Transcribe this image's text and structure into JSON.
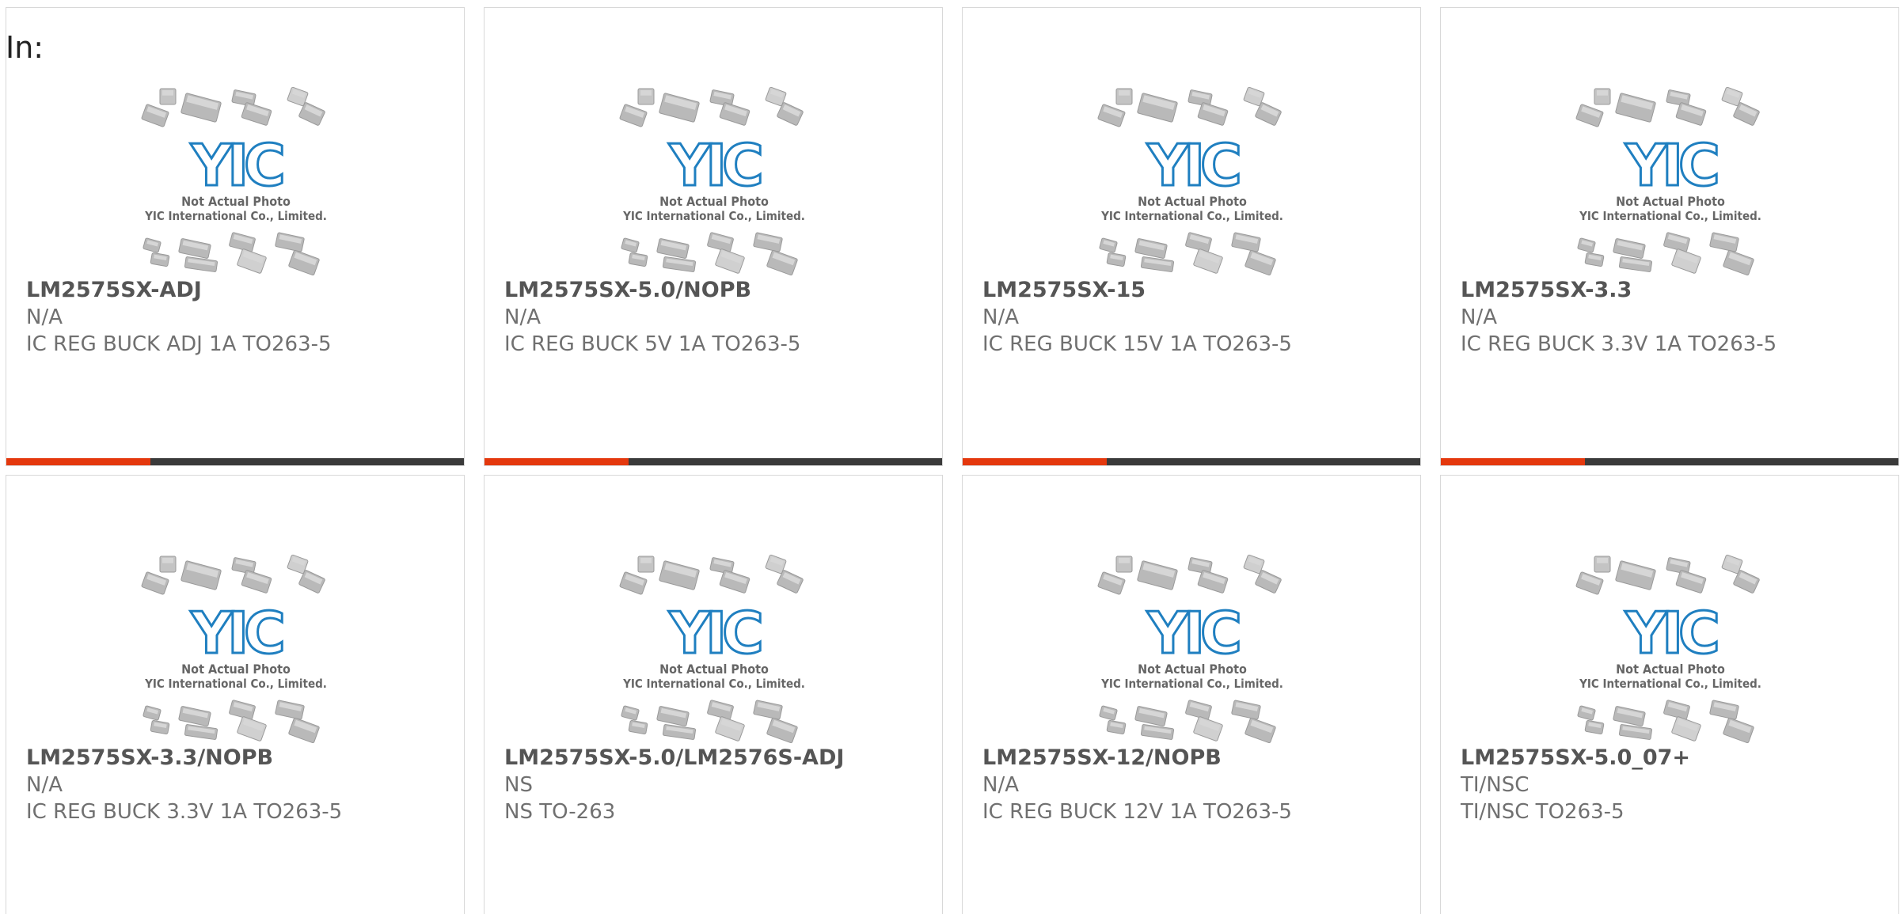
{
  "label": "In:",
  "thumbnail": {
    "logo_text": "YIC",
    "caption_line1": "Not Actual Photo",
    "caption_line2": "YIC International Co., Limited."
  },
  "colors": {
    "accent": "#e4380d",
    "bar": "#3a3a3a",
    "logo_blue": "#1f7fc0"
  },
  "products": [
    {
      "part": "LM2575SX-ADJ",
      "manufacturer": "N/A",
      "description": "IC REG BUCK ADJ 1A TO263-5"
    },
    {
      "part": "LM2575SX-5.0/NOPB",
      "manufacturer": "N/A",
      "description": "IC REG BUCK 5V 1A TO263-5"
    },
    {
      "part": "LM2575SX-15",
      "manufacturer": "N/A",
      "description": "IC REG BUCK 15V 1A TO263-5"
    },
    {
      "part": "LM2575SX-3.3",
      "manufacturer": "N/A",
      "description": "IC REG BUCK 3.3V 1A TO263-5"
    },
    {
      "part": "LM2575SX-3.3/NOPB",
      "manufacturer": "N/A",
      "description": "IC REG BUCK 3.3V 1A TO263-5"
    },
    {
      "part": "LM2575SX-5.0/LM2576S-ADJ",
      "manufacturer": "NS",
      "description": "NS TO-263"
    },
    {
      "part": "LM2575SX-12/NOPB",
      "manufacturer": "N/A",
      "description": "IC REG BUCK 12V 1A TO263-5"
    },
    {
      "part": "LM2575SX-5.0_07+",
      "manufacturer": "TI/NSC",
      "description": "TI/NSC TO263-5"
    }
  ]
}
